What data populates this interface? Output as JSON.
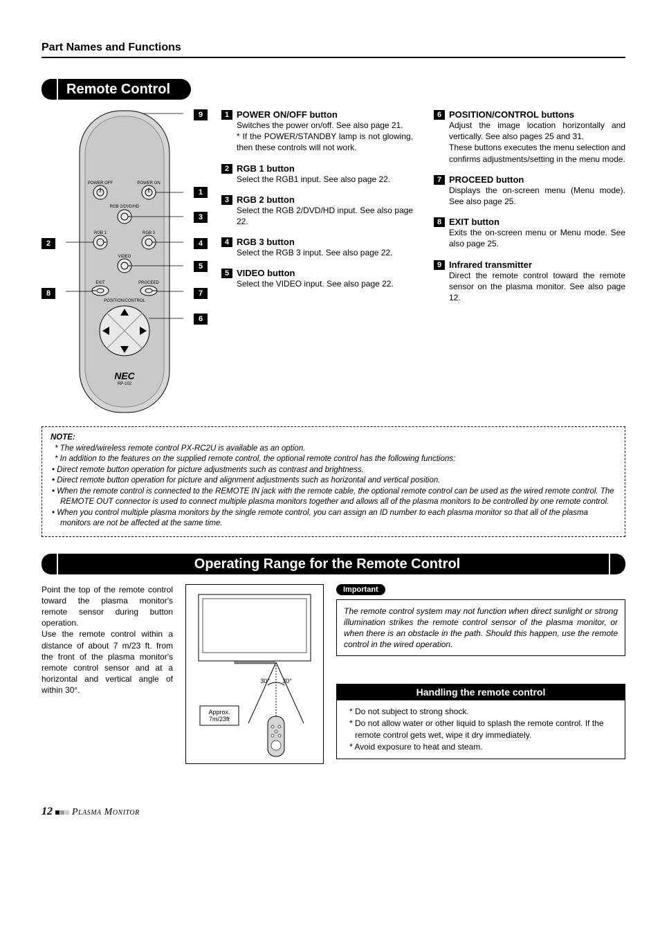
{
  "page_title": "Part Names and Functions",
  "section1_title": "Remote Control",
  "section2_title": "Operating Range for the Remote Control",
  "callouts": {
    "c1": "1",
    "c2": "2",
    "c3": "3",
    "c4": "4",
    "c5": "5",
    "c6": "6",
    "c7": "7",
    "c8": "8",
    "c9": "9"
  },
  "remote": {
    "power_off": "POWER OFF",
    "power_on": "POWER ON",
    "rgb2": "RGB 2/DVD/HD",
    "rgb1": "RGB 1",
    "rgb3": "RGB 3",
    "video": "VIDEO",
    "exit": "EXIT",
    "proceed": "PROCEED",
    "position": "POSITION/CONTROL",
    "brand": "NEC",
    "model": "RP-102"
  },
  "items_left": [
    {
      "num": "1",
      "title": "POWER ON/OFF button",
      "body": "Switches the power on/off. See also page 21.\n* If the POWER/STANDBY lamp is not glowing, then these controls will not work."
    },
    {
      "num": "2",
      "title": "RGB 1 button",
      "body": "Select the RGB1 input. See also page 22."
    },
    {
      "num": "3",
      "title": "RGB 2 button",
      "body": "Select the RGB 2/DVD/HD input. See also page 22."
    },
    {
      "num": "4",
      "title": "RGB 3 button",
      "body": "Select the RGB 3 input. See also page 22."
    },
    {
      "num": "5",
      "title": "VIDEO button",
      "body": "Select the VIDEO input. See also page 22."
    }
  ],
  "items_right": [
    {
      "num": "6",
      "title": "POSITION/CONTROL buttons",
      "body": "Adjust the image location horizontally and vertically.  See also pages 25 and 31.\nThese buttons executes the menu selection and confirms adjustments/setting in the menu mode."
    },
    {
      "num": "7",
      "title": "PROCEED button",
      "body": "Displays the on-screen menu (Menu mode). See also page 25."
    },
    {
      "num": "8",
      "title": "EXIT button",
      "body": "Exits the on-screen menu or Menu mode. See also page 25."
    },
    {
      "num": "9",
      "title": "Infrared transmitter",
      "body": "Direct the remote control toward the remote sensor on the plasma monitor. See also page 12."
    }
  ],
  "note": {
    "title": "NOTE:",
    "star1": "*  The wired/wireless remote control PX-RC2U is available as an option.",
    "star2": "*  In addition to the features on the supplied remote control, the optional remote control has the following functions:",
    "bullets": [
      "Direct remote button operation for picture adjustments such as contrast and brightness.",
      "Direct remote button operation for picture and alignment adjustments such as horizontal and vertical position.",
      "When the remote control is connected to the REMOTE IN jack with the remote cable, the optional remote control can be used as the wired remote control. The REMOTE OUT connector is used to connect multiple plasma monitors together and allows all of the plasma monitors to be controlled by one remote control.",
      "When you control multiple plasma monitors by the single remote control, you can assign an ID number to each plasma monitor so that all of the plasma monitors are not be affected at the same time."
    ]
  },
  "range_text": "Point the top of the remote control toward the plasma monitor's remote sensor during button operation.\nUse the remote control within a distance of about 7 m/23 ft. from the front of the plasma monitor's remote control sensor and at a horizontal and vertical angle of within 30°.",
  "range_diagram": {
    "angle_l": "30°",
    "angle_r": "30°",
    "dist": "Approx. 7m/23ft"
  },
  "important": {
    "label": "Important",
    "body": "The remote control system may not function when direct sunlight or strong illumination strikes the remote control sensor of the plasma monitor, or when there is an obstacle in the path. Should this happen, use the remote control in the wired operation."
  },
  "handling": {
    "title": "Handling the remote control",
    "lines": [
      "* Do not subject to strong shock.",
      "* Do not allow water or other liquid to splash the remote control. If the remote control gets wet, wipe it dry immediately.",
      "* Avoid exposure to heat and steam."
    ]
  },
  "footer": {
    "page": "12",
    "product": "Plasma Monitor"
  }
}
